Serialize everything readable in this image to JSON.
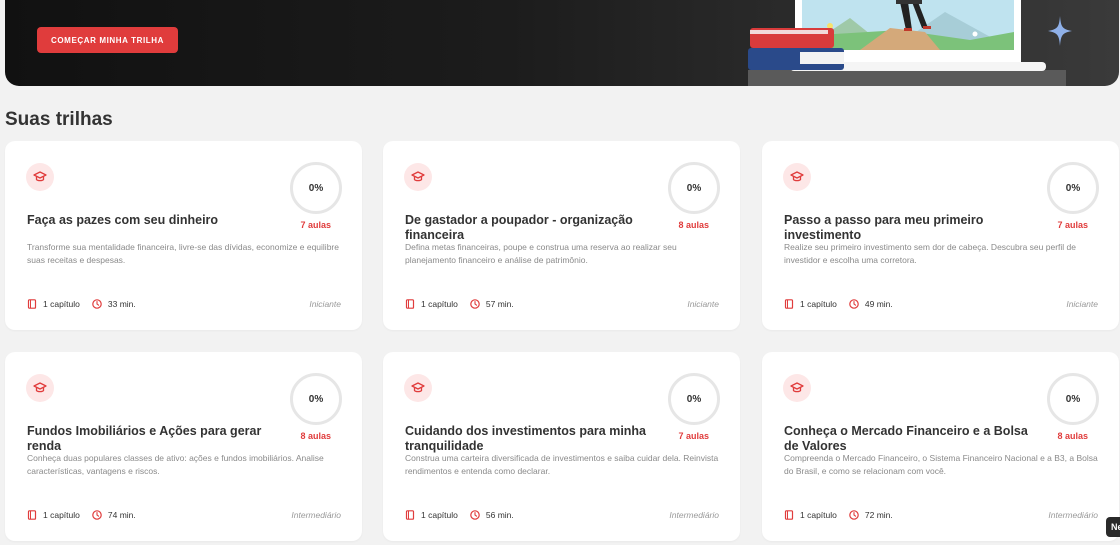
{
  "hero": {
    "cta_label": "COMEÇAR MINHA TRILHA"
  },
  "section": {
    "title": "Suas trilhas"
  },
  "colors": {
    "accent": "#e03c3c",
    "hero_bg": "#1a1a1a",
    "page_bg": "#f2f2f2"
  },
  "icons": {
    "track": "graduation-cap-icon",
    "chapters": "book-icon",
    "duration": "clock-icon"
  },
  "cards": [
    {
      "title": "Faça as pazes com seu dinheiro",
      "progress": "0%",
      "lessons": "7 aulas",
      "description": "Transforme sua mentalidade financeira, livre-se das dívidas, economize e equilibre suas receitas e despesas.",
      "chapters": "1 capítulo",
      "duration": "33 min.",
      "level": "Iniciante"
    },
    {
      "title": "De gastador a poupador - organização financeira",
      "progress": "0%",
      "lessons": "8 aulas",
      "description": "Defina metas financeiras, poupe e construa uma reserva ao realizar seu planejamento financeiro e análise de patrimônio.",
      "chapters": "1 capítulo",
      "duration": "57 min.",
      "level": "Iniciante"
    },
    {
      "title": "Passo a passo para meu primeiro investimento",
      "progress": "0%",
      "lessons": "7 aulas",
      "description": "Realize seu primeiro investimento sem dor de cabeça. Descubra seu perfil de investidor e escolha uma corretora.",
      "chapters": "1 capítulo",
      "duration": "49 min.",
      "level": "Iniciante"
    },
    {
      "title": "Fundos Imobiliários e Ações para gerar renda",
      "progress": "0%",
      "lessons": "8 aulas",
      "description": "Conheça duas populares classes de ativo: ações e fundos imobiliários. Analise características, vantagens e riscos.",
      "chapters": "1 capítulo",
      "duration": "74 min.",
      "level": "Intermediário"
    },
    {
      "title": "Cuidando dos investimentos para minha tranquilidade",
      "progress": "0%",
      "lessons": "7 aulas",
      "description": "Construa uma carteira diversificada de investimentos e saiba cuidar dela. Reinvista rendimentos e entenda como declarar.",
      "chapters": "1 capítulo",
      "duration": "56 min.",
      "level": "Intermediário"
    },
    {
      "title": "Conheça o Mercado Financeiro e a Bolsa de Valores",
      "progress": "0%",
      "lessons": "8 aulas",
      "description": "Compreenda o Mercado Financeiro, o Sistema Financeiro Nacional e a B3, a Bolsa do Brasil, e como se relacionam com você.",
      "chapters": "1 capítulo",
      "duration": "72 min.",
      "level": "Intermediário"
    }
  ],
  "chat_tab": {
    "label": "Ne"
  }
}
